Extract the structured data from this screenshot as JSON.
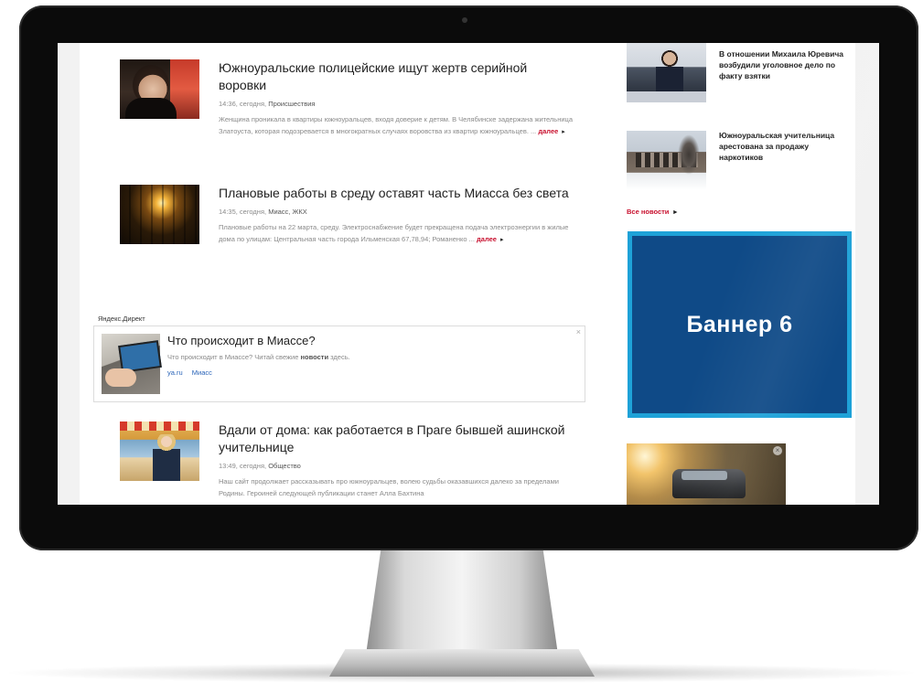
{
  "articles": [
    {
      "title": "Южноуральские полицейские ищут жертв серийной воровки",
      "meta_time": "14:36, сегодня,",
      "meta_category": "Происшествия",
      "text": "Женщина проникала в квартиры южноуральцев, входя доверие к детям. В Челябинске задержана жительница Златоуста, которая подозревается в многократных случаях воровства из квартир южноуральцев. ...",
      "more_label": "далее",
      "more_arrow": "▸"
    },
    {
      "title": "Плановые работы в среду оставят часть Миасса без света",
      "meta_time": "14:35, сегодня,",
      "meta_category": "Миасс, ЖКХ",
      "text": "Плановые работы на 22 марта, среду. Электроснабжение будет прекращена подача электроэнергии в жилые дома по улицам: Центральная часть города Ильменская 67,78,94; Романенко ...",
      "more_label": "далее",
      "more_arrow": "▸"
    },
    {
      "title": "Вдали от дома: как работается в Праге бывшей ашинской учительнице",
      "meta_time": "13:49, сегодня,",
      "meta_category": "Общество",
      "text": "Наш сайт продолжает рассказывать про южноуральцев, волею судьбы оказавшихся далеко за пределами Родины. Героиней следующей публикации станет Алла Бахтина",
      "more_label": "",
      "more_arrow": ""
    }
  ],
  "yandex_direct": {
    "label": "Яндекс.Директ",
    "title": "Что происходит в Миассе?",
    "text_before": "Что происходит в Миассе? Читай свежие",
    "text_bold": "новости",
    "text_after": "здесь.",
    "link_domain": "ya.ru",
    "link_region": "Миасс",
    "close": "×"
  },
  "sidebar": {
    "items": [
      {
        "text": "В отношении Михаила Юревича возбудили уголовное дело по факту взятки"
      },
      {
        "text": "Южноуральская учительница арестована за продажу наркотиков"
      }
    ],
    "all_news_label": "Все новости",
    "all_news_arrow": "▸"
  },
  "banner": {
    "label": "Баннер 6",
    "bg_color": "#0f4a87",
    "border_color": "#1ea2d8"
  },
  "car_ad": {
    "close": "×"
  },
  "colors": {
    "accent_red": "#c8102e",
    "link_blue": "#2a64b8"
  }
}
